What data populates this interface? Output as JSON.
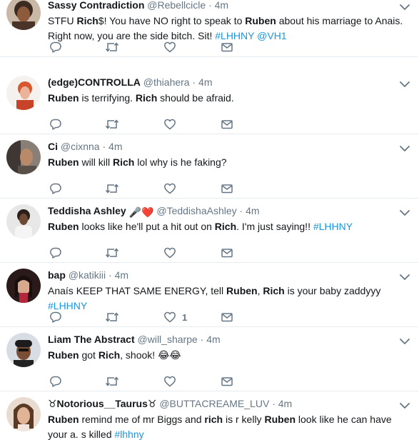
{
  "tweets": [
    {
      "name": "Sassy Contradiction",
      "handle": "@Rebellcicle",
      "time": "4m",
      "text": [
        {
          "t": "STFU "
        },
        {
          "b": "Rich"
        },
        {
          "t": "$! You have NO right to speak to "
        },
        {
          "b": "Ruben"
        },
        {
          "t": " about his marriage to Anais. Right now, you are the side bitch. Sit! "
        },
        {
          "tag": "#LHHNY"
        },
        {
          "t": " "
        },
        {
          "tag": "@VH1"
        }
      ],
      "like_count": "",
      "avatar": "avatar-1"
    },
    {
      "name": "(edge)CONTROLLA",
      "handle": "@thiahera",
      "time": "4m",
      "text": [
        {
          "b": "Ruben"
        },
        {
          "t": " is terrifying. "
        },
        {
          "b": "Rich"
        },
        {
          "t": " should be afraid."
        }
      ],
      "like_count": "",
      "avatar": "avatar-2"
    },
    {
      "name": "Ci",
      "handle": "@cixnna",
      "time": "4m",
      "text": [
        {
          "b": "Ruben"
        },
        {
          "t": " will kill "
        },
        {
          "b": "Rich"
        },
        {
          "t": " lol why is he faking?"
        }
      ],
      "like_count": "",
      "avatar": "avatar-3"
    },
    {
      "name": "Teddisha Ashley",
      "badge": "🎤❤️",
      "handle": "@TeddishaAshley",
      "time": "4m",
      "text": [
        {
          "b": "Ruben"
        },
        {
          "t": " looks like he'll put a hit out on "
        },
        {
          "b": "Rich"
        },
        {
          "t": ". I'm just saying!! "
        },
        {
          "tag": "#LHHNY"
        }
      ],
      "like_count": "",
      "avatar": "avatar-4"
    },
    {
      "name": "bap",
      "handle": "@katikiii",
      "time": "4m",
      "text": [
        {
          "t": "Anaís KEEP THAT SAME ENERGY, tell "
        },
        {
          "b": "Ruben"
        },
        {
          "t": ", "
        },
        {
          "b": "Rich"
        },
        {
          "t": " is your baby zaddyyy "
        },
        {
          "tag": "#LHHNY"
        }
      ],
      "like_count": "1",
      "avatar": "avatar-5"
    },
    {
      "name": "Liam The Abstract",
      "handle": "@will_sharpe",
      "time": "4m",
      "text": [
        {
          "b": "Ruben"
        },
        {
          "t": " got "
        },
        {
          "b": "Rich"
        },
        {
          "t": ", shook! 😂😂"
        }
      ],
      "like_count": "",
      "avatar": "avatar-6"
    },
    {
      "name": "♉Notorious__Taurus♉",
      "handle": "@BUTTACREAME_LUV",
      "time": "4m",
      "text": [
        {
          "b": "Ruben"
        },
        {
          "t": " remind me of mr Biggs and "
        },
        {
          "b": "rich"
        },
        {
          "t": " is r kelly "
        },
        {
          "b": "Ruben"
        },
        {
          "t": " look like he can have your a. s killed "
        },
        {
          "tag": "#lhhny"
        }
      ],
      "like_count": "",
      "avatar": "avatar-7"
    }
  ],
  "colors": {
    "text": "#14171a",
    "muted": "#657786",
    "link": "#1b95e0",
    "border": "#e6ecf0"
  }
}
